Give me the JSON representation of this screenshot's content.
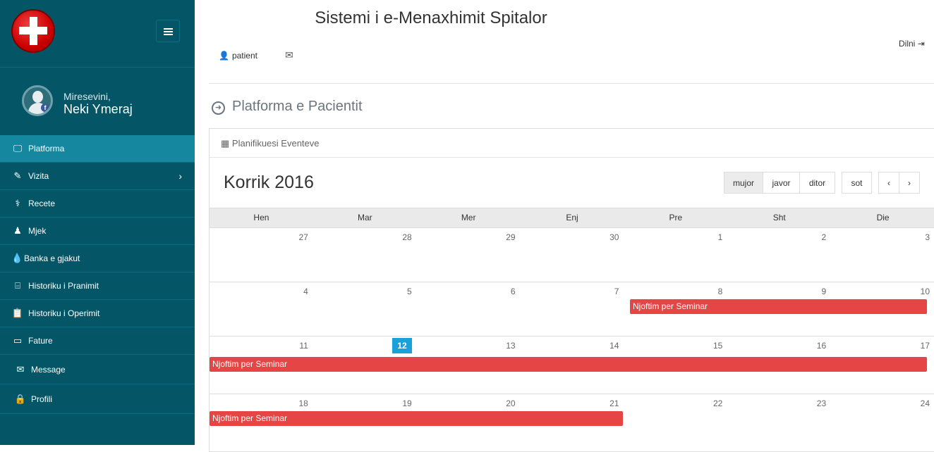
{
  "app": {
    "title": "Sistemi i e-Menaxhimit Spitalor"
  },
  "user": {
    "greeting": "Miresevini,",
    "name": "Neki Ymeraj",
    "role_link": "patient"
  },
  "header": {
    "logout_label": "Dilni"
  },
  "sidebar": {
    "items": [
      {
        "label": "Platforma",
        "icon": "monitor-icon"
      },
      {
        "label": "Vizita",
        "icon": "edit-icon"
      },
      {
        "label": "Recete",
        "icon": "stethoscope-icon"
      },
      {
        "label": "Mjek",
        "icon": "doctor-icon"
      },
      {
        "label": "Banka e gjakut",
        "icon": "drop-icon"
      },
      {
        "label": "Historiku i Pranimit",
        "icon": "bed-icon"
      },
      {
        "label": "Historiku i Operimit",
        "icon": "clipboard-icon"
      },
      {
        "label": "Fature",
        "icon": "card-icon"
      },
      {
        "label": "Message",
        "icon": "envelope-icon"
      },
      {
        "label": "Profili",
        "icon": "lock-icon"
      }
    ]
  },
  "page": {
    "heading": "Platforma e Pacientit"
  },
  "panel": {
    "title": "Planifikuesi Eventeve"
  },
  "calendar": {
    "month_title": "Korrik 2016",
    "views": {
      "month": "mujor",
      "week": "javor",
      "day": "ditor"
    },
    "today_label": "sot",
    "prev": "‹",
    "next": "›",
    "weekdays": [
      "Hen",
      "Mar",
      "Mer",
      "Enj",
      "Pre",
      "Sht",
      "Die"
    ],
    "weeks": [
      [
        "27",
        "28",
        "29",
        "30",
        "1",
        "2",
        "3"
      ],
      [
        "4",
        "5",
        "6",
        "7",
        "8",
        "9",
        "10"
      ],
      [
        "11",
        "12",
        "13",
        "14",
        "15",
        "16",
        "17"
      ],
      [
        "18",
        "19",
        "20",
        "21",
        "22",
        "23",
        "24"
      ]
    ],
    "today": "12",
    "event_title": "Njoftim per Seminar"
  },
  "colors": {
    "sidebar": "#045666",
    "active": "#1588a0",
    "event": "#e64545",
    "today": "#1aa1d8"
  }
}
